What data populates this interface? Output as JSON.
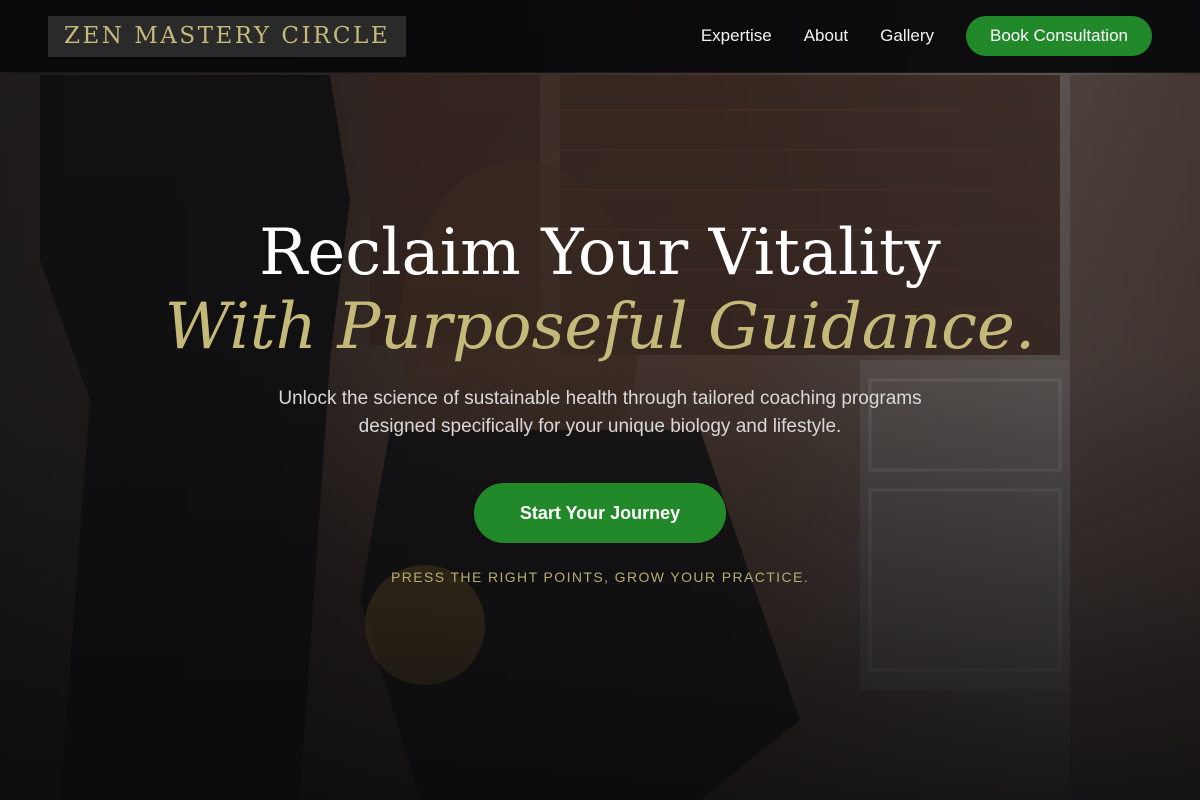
{
  "brand": {
    "logo_text": "ZEN MASTERY CIRCLE"
  },
  "nav": {
    "items": [
      {
        "label": "Expertise"
      },
      {
        "label": "About"
      },
      {
        "label": "Gallery"
      }
    ],
    "cta_label": "Book Consultation"
  },
  "hero": {
    "title": "Reclaim Your Vitality",
    "title_accent": "With Purposeful Guidance.",
    "subtitle": "Unlock the science of sustainable health through tailored coaching programs designed specifically for your unique biology and lifestyle.",
    "cta_label": "Start Your Journey",
    "tagline": "PRESS THE RIGHT POINTS, GROW YOUR PRACTICE."
  },
  "colors": {
    "accent_gold": "#c5b97a",
    "button_green": "#22892b",
    "header_bg": "#0b0b0c"
  }
}
